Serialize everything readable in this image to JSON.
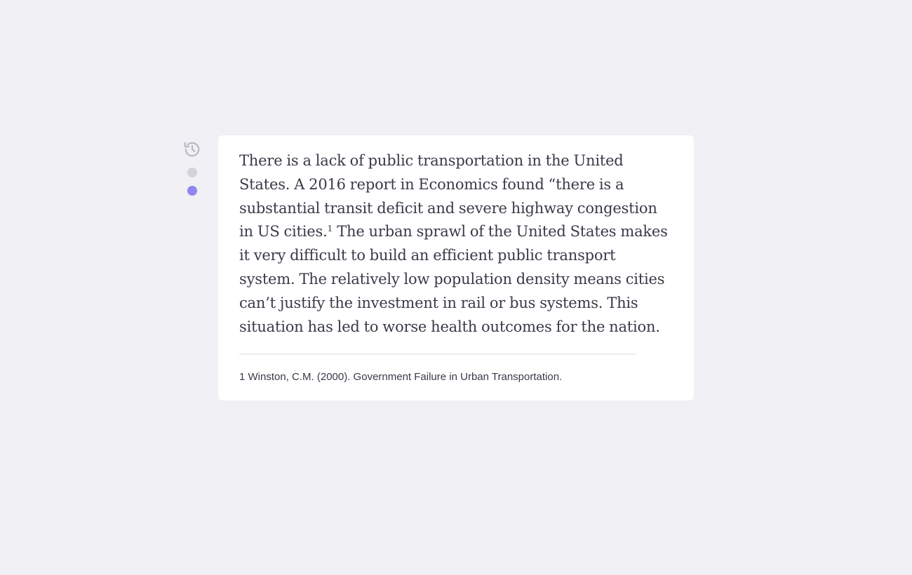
{
  "rail": {
    "history_icon": "history-icon",
    "history_icon_color": "#b8b8c6",
    "dots": [
      {
        "state": "inactive",
        "color": "#d3d3dc"
      },
      {
        "state": "active",
        "color": "#8f86ef"
      }
    ]
  },
  "card": {
    "paragraph": {
      "before_ref": "There is a lack of public transportation in the United States. A 2016 report in Economics found “there is a substantial transit deficit and severe highway congestion in US cities.",
      "ref": "1",
      "after_ref": " The urban sprawl of the United States makes it very difficult to build an efficient public transport system. The relatively low population density means cities can’t justify the investment in rail or bus systems. This situation has led to worse health outcomes for the nation."
    },
    "footnote": {
      "number": "1",
      "text": "Winston, C.M. (2000). Government Failure in Urban Transportation."
    }
  },
  "colors": {
    "background": "#f0f0f5",
    "card": "#ffffff",
    "text": "#3a3a48",
    "accent": "#8f86ef",
    "rule": "#ededf0"
  }
}
